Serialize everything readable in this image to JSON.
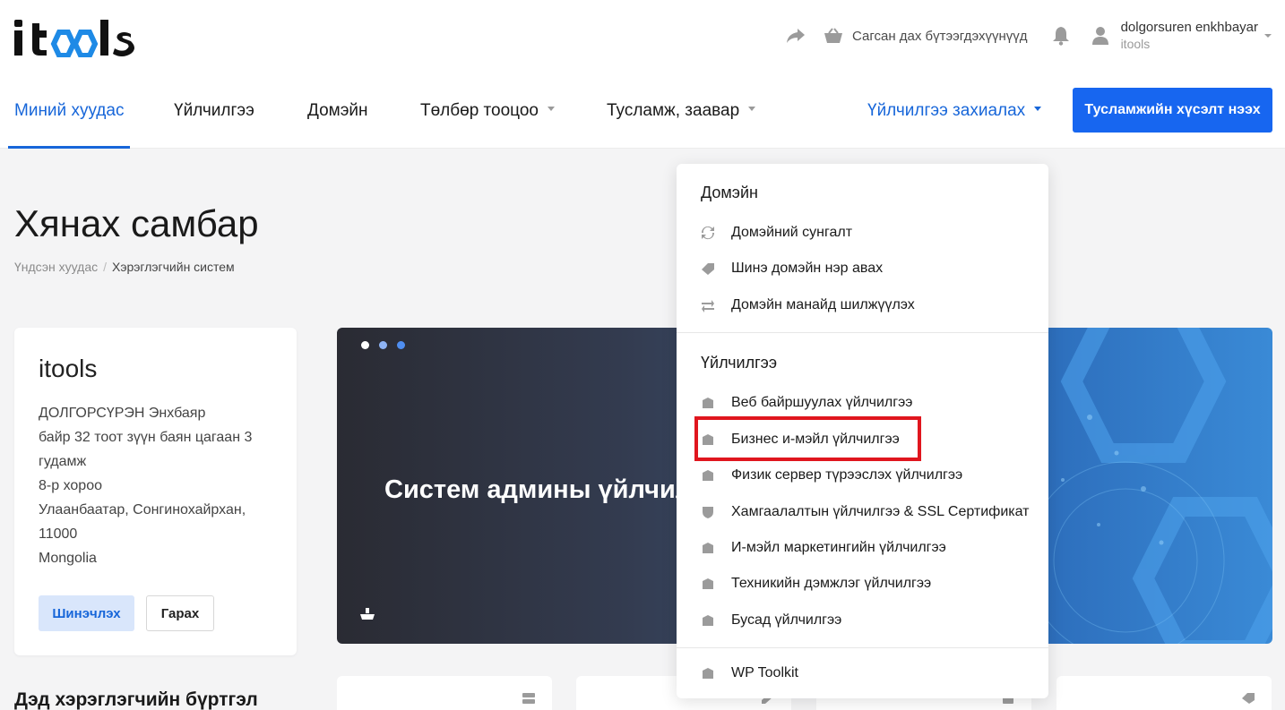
{
  "header": {
    "logo_text": "itools",
    "cart_label": "Сагсан дах бүтээгдэхүүнүүд",
    "user_name": "dolgorsuren enkhbayar",
    "user_org": "itools"
  },
  "nav": {
    "items": [
      {
        "label": "Миний хуудас"
      },
      {
        "label": "Үйлчилгээ"
      },
      {
        "label": "Домэйн"
      },
      {
        "label": "Төлбөр тооцоо"
      },
      {
        "label": "Тусламж, заавар"
      }
    ],
    "order_label": "Үйлчилгээ захиалах",
    "support_button": "Тусламжийн хүсэлт нээх"
  },
  "page": {
    "title": "Хянах самбар",
    "breadcrumb_home": "Үндсэн хуудас",
    "breadcrumb_current": "Хэрэглэгчийн систем"
  },
  "profile": {
    "company": "itools",
    "address_lines": [
      "ДОЛГОРСҮРЭН Энхбаяр",
      "байр 32 тоот зүүн баян цагаан 3 гудамж",
      "8-р хороо",
      "Улаанбаатар, Сонгинохайрхан, 11000",
      "Mongolia"
    ],
    "update_button": "Шинэчлэх",
    "logout_button": "Гарах"
  },
  "banner": {
    "text": "Систем админы үйлчил"
  },
  "section_heading": "Дэд хэрэглэгчийн бүртгэл",
  "dropdown": {
    "domain_header": "Домэйн",
    "domain_items": [
      {
        "label": "Домэйний сунгалт",
        "icon": "refresh-icon"
      },
      {
        "label": "Шинэ домэйн нэр авах",
        "icon": "tag-icon"
      },
      {
        "label": "Домэйн манайд шилжүүлэх",
        "icon": "transfer-icon"
      }
    ],
    "service_header": "Үйлчилгээ",
    "service_items": [
      {
        "label": "Веб байршуулах үйлчилгээ",
        "icon": "box-icon"
      },
      {
        "label": "Бизнес и-мэйл үйлчилгээ",
        "icon": "box-icon"
      },
      {
        "label": "Физик сервер түрээслэх үйлчилгээ",
        "icon": "box-icon"
      },
      {
        "label": "Хамгаалалтын үйлчилгээ & SSL Сертификат",
        "icon": "shield-icon"
      },
      {
        "label": "И-мэйл маркетингийн үйлчилгээ",
        "icon": "box-icon"
      },
      {
        "label": "Техникийн дэмжлэг үйлчилгээ",
        "icon": "box-icon"
      },
      {
        "label": "Бусад үйлчилгээ",
        "icon": "box-icon"
      }
    ],
    "extra_items": [
      {
        "label": "WP Toolkit",
        "icon": "box-icon"
      }
    ]
  },
  "colors": {
    "accent": "#1766d9",
    "button_primary": "#1766f0",
    "highlight": "#e0161e",
    "icon_gray": "#9b9b9b"
  }
}
